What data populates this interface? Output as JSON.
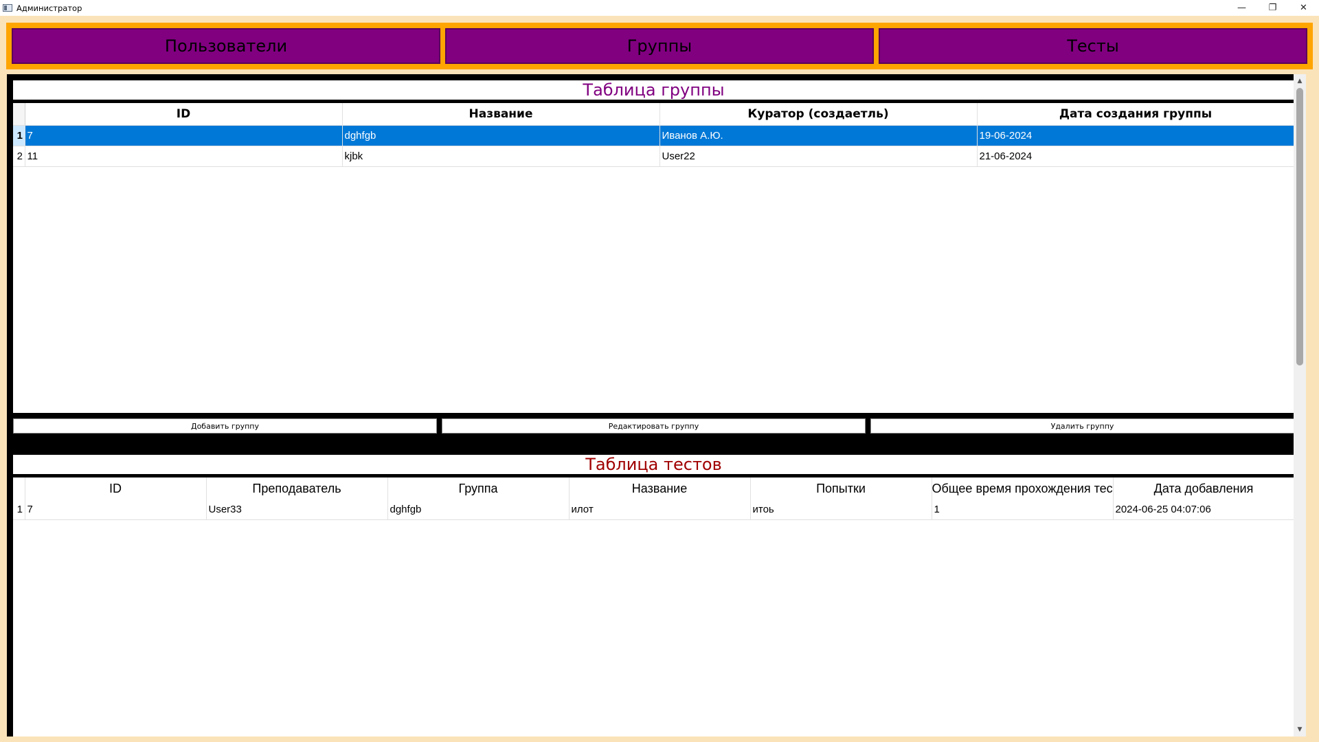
{
  "window": {
    "title": "Администратор",
    "minimize": "—",
    "restore": "❐",
    "close": "✕"
  },
  "nav": {
    "users": "Пользователи",
    "groups": "Группы",
    "tests": "Тесты"
  },
  "colors": {
    "nav_bg": "#ffa500",
    "nav_button": "#800080",
    "groups_title": "#800080",
    "tests_title": "#a00000",
    "selection": "#0078d7"
  },
  "groups_section": {
    "title": "Таблица группы",
    "columns": [
      "ID",
      "Название",
      "Куратор (создаетль)",
      "Дата создания группы"
    ],
    "rows": [
      {
        "num": "1",
        "cells": [
          "7",
          "dghfgb",
          "Иванов А.Ю.",
          "19-06-2024"
        ],
        "selected": true
      },
      {
        "num": "2",
        "cells": [
          "11",
          "kjbk",
          "User22",
          "21-06-2024"
        ],
        "selected": false
      }
    ],
    "buttons": {
      "add": "Добавить группу",
      "edit": "Редактировать группу",
      "delete": "Удалить группу"
    }
  },
  "tests_section": {
    "title": "Таблица тестов",
    "columns": [
      "ID",
      "Преподаватель",
      "Группа",
      "Название",
      "Попытки",
      "Общее время прохождения тест",
      "Дата добавления"
    ],
    "rows": [
      {
        "num": "1",
        "cells": [
          "7",
          "User33",
          "dghfgb",
          "илот",
          "итоь",
          "1",
          "2024-06-25 04:07:06"
        ]
      }
    ]
  },
  "scrollbar": {
    "up": "▲",
    "down": "▼"
  }
}
